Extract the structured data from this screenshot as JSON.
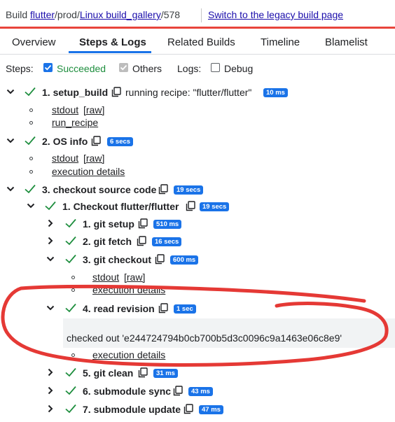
{
  "breadcrumb": {
    "prefix": "Build",
    "project": "flutter",
    "bucket": "/prod/",
    "builder": "Linux build_gallery",
    "slash": "/",
    "number": "578",
    "legacy_link": "Switch to the legacy build page"
  },
  "tabs": [
    "Overview",
    "Steps & Logs",
    "Related Builds",
    "Timeline",
    "Blamelist"
  ],
  "active_tab": "Steps & Logs",
  "filters": {
    "steps_label": "Steps:",
    "succeeded": "Succeeded",
    "succeeded_checked": true,
    "others": "Others",
    "others_checked": true,
    "logs_label": "Logs:",
    "debug": "Debug",
    "debug_checked": false
  },
  "steps": [
    {
      "title": "1. setup_build",
      "summary": "running recipe: \"flutter/flutter\"",
      "duration": "10 ms",
      "logs": [
        {
          "text": "stdout"
        },
        {
          "text": "[raw]"
        },
        {
          "text": "run_recipe"
        }
      ]
    },
    {
      "title": "2. OS info",
      "duration": "6 secs",
      "logs": [
        {
          "text": "stdout"
        },
        {
          "text": "[raw]"
        },
        {
          "text": "execution details"
        }
      ]
    },
    {
      "title": "3. checkout source code",
      "duration": "19 secs"
    },
    {
      "title": "1. Checkout flutter/flutter",
      "duration": "19 secs"
    },
    {
      "title": "1. git setup",
      "duration": "510 ms"
    },
    {
      "title": "2. git fetch",
      "duration": "16 secs"
    },
    {
      "title": "3. git checkout",
      "duration": "600 ms",
      "logs": [
        {
          "text": "stdout"
        },
        {
          "text": "[raw]"
        },
        {
          "text": "execution details"
        }
      ]
    },
    {
      "title": "4. read revision",
      "duration": "1 sec",
      "summary": "checked out 'e244724794b0cb700b5d3c0096c9a1463e06c8e9'",
      "logs": [
        {
          "text": "execution details"
        }
      ]
    },
    {
      "title": "5. git clean",
      "duration": "31 ms"
    },
    {
      "title": "6. submodule sync",
      "duration": "43 ms"
    },
    {
      "title": "7. submodule update",
      "duration": "47 ms"
    }
  ],
  "colors": {
    "accent": "#1a73e8",
    "success": "#1e8e3e",
    "link": "#1a0dab",
    "annotation": "#e53935"
  }
}
